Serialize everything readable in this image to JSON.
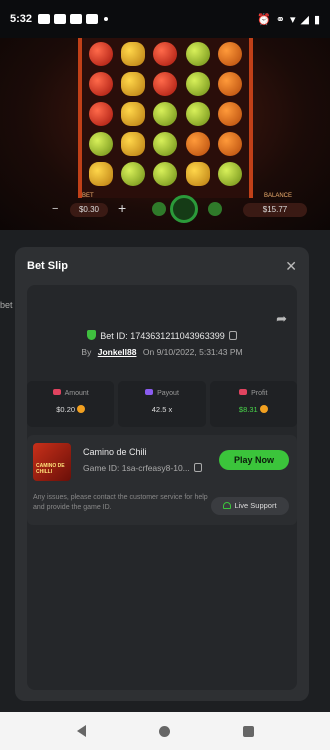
{
  "status_bar": {
    "time": "5:32"
  },
  "game": {
    "bet_label": "BET",
    "bet_value": "$0.30",
    "balance_label": "BALANCE",
    "balance_value": "$15.77"
  },
  "side": {
    "bet_fragment": "bet"
  },
  "modal": {
    "title": "Bet Slip",
    "bet_id_label": "Bet ID: 1743631211043963399",
    "by_prefix": "By",
    "user": "Jonkell88",
    "on_prefix": "On",
    "date": "9/10/2022, 5:31:43 PM",
    "stats": {
      "amount_label": "Amount",
      "amount_value": "$0.20",
      "payout_label": "Payout",
      "payout_value": "42.5 x",
      "profit_label": "Profit",
      "profit_value": "$8.31"
    },
    "game_card": {
      "name": "Camino de Chili",
      "game_id": "Game ID: 1sa-crfeasy8-10...",
      "thumb_text": "CAMINO DE CHILLI",
      "play_label": "Play Now",
      "help_text": "Any issues, please contact the customer service for help and provide the game ID.",
      "support_label": "Live Support"
    }
  },
  "colors": {
    "accent_green": "#3bc43b",
    "profit_green": "#48d64a",
    "modal_bg": "#2e3033"
  }
}
